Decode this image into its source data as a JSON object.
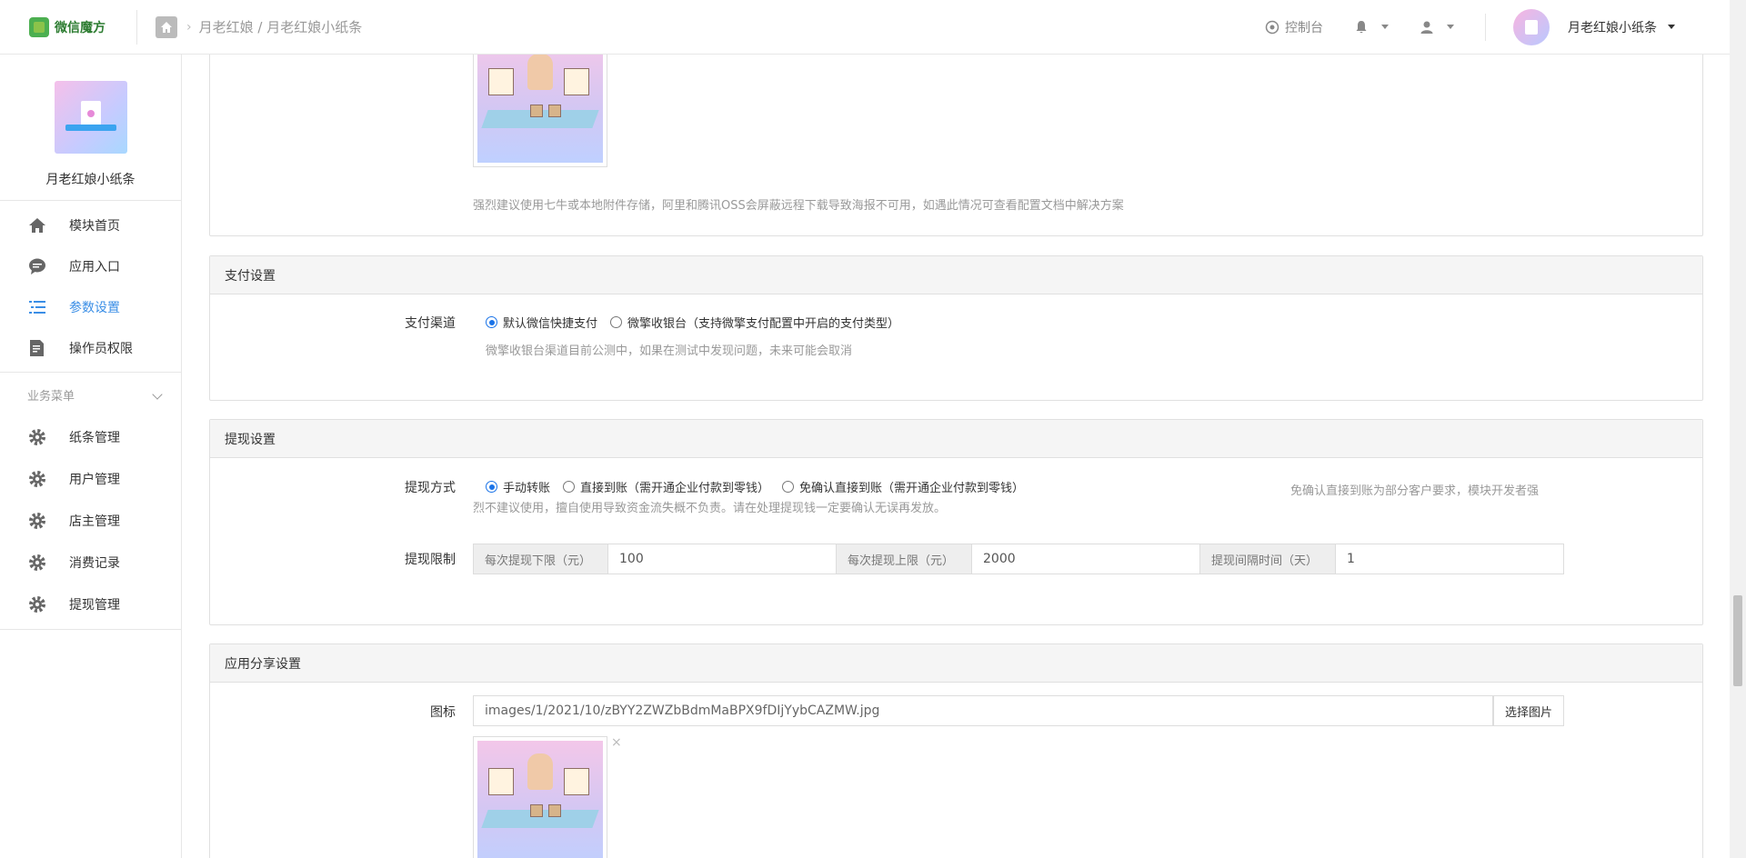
{
  "header": {
    "logo_text": "微信魔方",
    "breadcrumb": "月老红娘 / 月老红娘小纸条",
    "console": "控制台",
    "username": "月老红娘小纸条"
  },
  "sidebar": {
    "app_name": "月老红娘小纸条",
    "items": [
      {
        "label": "模块首页"
      },
      {
        "label": "应用入口"
      },
      {
        "label": "参数设置"
      },
      {
        "label": "操作员权限"
      }
    ],
    "section_title": "业务菜单",
    "biz_items": [
      {
        "label": "纸条管理"
      },
      {
        "label": "用户管理"
      },
      {
        "label": "店主管理"
      },
      {
        "label": "消费记录"
      },
      {
        "label": "提现管理"
      }
    ]
  },
  "poster_section": {
    "hint": "强烈建议使用七牛或本地附件存储，阿里和腾讯OSS会屏蔽远程下载导致海报不可用，如遇此情况可查看配置文档中解决方案"
  },
  "payment": {
    "title": "支付设置",
    "channel_label": "支付渠道",
    "options": [
      "默认微信快捷支付",
      "微擎收银台（支持微擎支付配置中开启的支付类型）"
    ],
    "selected": 0,
    "hint": "微擎收银台渠道目前公测中，如果在测试中发现问题，未来可能会取消"
  },
  "withdraw": {
    "title": "提现设置",
    "method_label": "提现方式",
    "options": [
      "手动转账",
      "直接到账（需开通企业付款到零钱）",
      "免确认直接到账（需开通企业付款到零钱）"
    ],
    "selected": 0,
    "note_right": "免确认直接到账为部分客户要求，模块开发者强",
    "note_line2": "烈不建议使用，擅自使用导致资金流失概不负责。请在处理提现钱一定要确认无误再发放。",
    "limit_label": "提现限制",
    "min_label": "每次提现下限（元）",
    "min_value": "100",
    "max_label": "每次提现上限（元）",
    "max_value": "2000",
    "interval_label": "提现间隔时间（天）",
    "interval_value": "1"
  },
  "share": {
    "title": "应用分享设置",
    "icon_label": "图标",
    "icon_path": "images/1/2021/10/zBYY2ZWZbBdmMaBPX9fDIjYybCAZMW.jpg",
    "select_button": "选择图片",
    "remove_symbol": "×"
  }
}
